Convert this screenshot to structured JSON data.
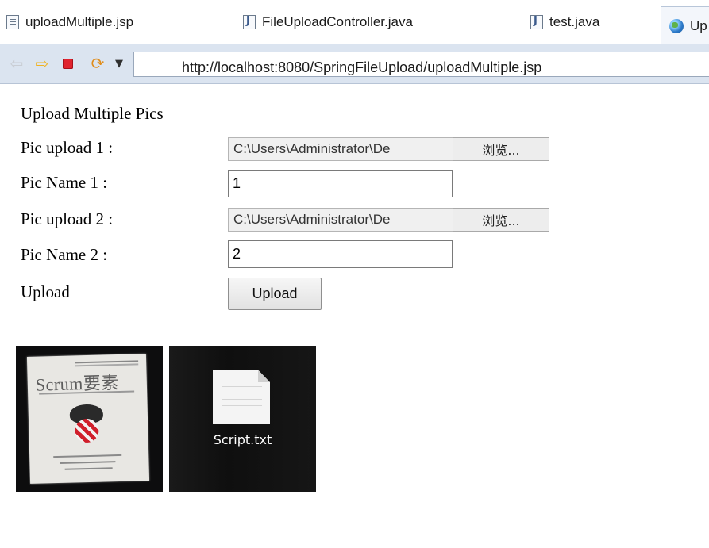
{
  "tabs": [
    {
      "label": "uploadMultiple.jsp",
      "icon": "jsp-file-icon"
    },
    {
      "label": "FileUploadController.java",
      "icon": "java-file-icon"
    },
    {
      "label": "test.java",
      "icon": "java-file-icon"
    },
    {
      "label": "Up",
      "icon": "globe-icon"
    }
  ],
  "nav": {
    "url": "http://localhost:8080/SpringFileUpload/uploadMultiple.jsp"
  },
  "page": {
    "title": "Upload Multiple Pics",
    "rows": [
      {
        "label": "Pic upload 1 :",
        "path": "C:\\Users\\Administrator\\De",
        "browse": "浏览..."
      },
      {
        "label": "Pic Name 1 :",
        "value": "1"
      },
      {
        "label": "Pic upload 2 :",
        "path": "C:\\Users\\Administrator\\De",
        "browse": "浏览..."
      },
      {
        "label": "Pic Name 2 :",
        "value": "2"
      }
    ],
    "upload_label": "Upload",
    "upload_button": "Upload"
  },
  "thumbnails": [
    {
      "type": "book-photo",
      "cover_text": "Scrum要素"
    },
    {
      "type": "file-icon",
      "caption": "Script.txt"
    }
  ],
  "colors": {
    "nav_bg": "#dbe4f0",
    "stop_red": "#e0232e",
    "forward_orange": "#f0b321"
  }
}
